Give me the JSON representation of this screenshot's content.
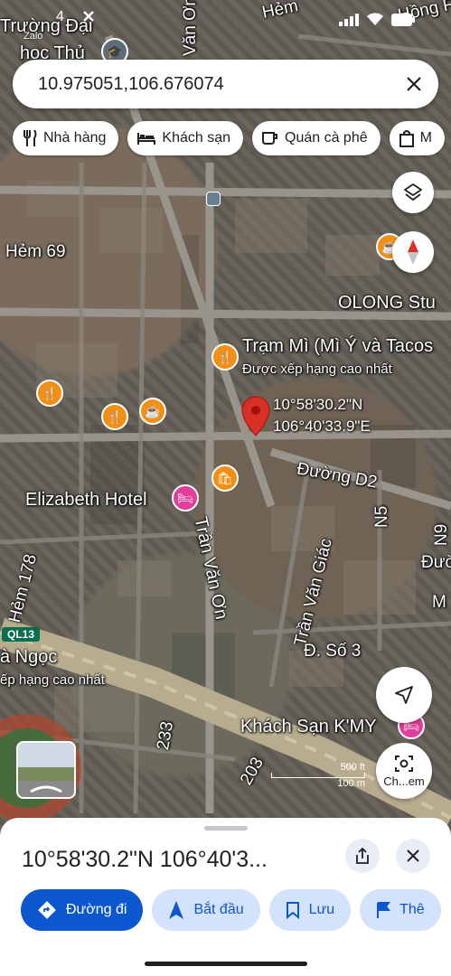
{
  "status_bar": {
    "time": "4",
    "zalo_label": "Zalo"
  },
  "search": {
    "query": "10.975051,106.676074"
  },
  "chips": [
    {
      "label": "Nhà hàng",
      "icon": "restaurant-icon"
    },
    {
      "label": "Khách sạn",
      "icon": "hotel-icon"
    },
    {
      "label": "Quán cà phê",
      "icon": "coffee-icon"
    },
    {
      "label": "M",
      "icon": "shopping-bag-icon"
    }
  ],
  "map": {
    "labels": {
      "truong_dai": "Trường Đại",
      "hoc_thu": "học Thủ",
      "hem_top": "Hẻm",
      "hong_fr": "Hồng Fr",
      "van_on_top": "Văn Ơn",
      "hem_69": "Hẻm 69",
      "olong": "OLONG Stu",
      "tram_mi": "Trạm Mì (Mì Ý và Tacos",
      "tram_mi_sub": "Được xếp hạng cao nhất",
      "elizabeth": "Elizabeth Hotel",
      "duong_d2": "Đường D2",
      "n5": "N5",
      "n9": "N9",
      "duong_right": "Đườ",
      "m_right": "M",
      "tran_van_on": "Trần Văn Ơn",
      "tran_van_giac": "Trần Văn Giác",
      "d_so_3": "Đ. Số 3",
      "hem_178": "Hẻm 178",
      "ql13": "QL13",
      "a_ngoc": "à Ngọc",
      "xep_hang": "ếp hạng cao nhất",
      "khach_san_kmy": "Khách Sạn K'MY",
      "road_233": "233",
      "road_203": "203"
    },
    "pin": {
      "lat": "10°58'30.2\"N",
      "lng": "106°40'33.9\"E"
    },
    "scale": {
      "ft": "500 ft",
      "m": "100 m"
    },
    "lens_label": "Ch...em"
  },
  "sheet": {
    "title": "10°58'30.2\"N 106°40'3...",
    "actions": [
      {
        "label": "Đường đi",
        "icon": "directions-icon",
        "primary": true
      },
      {
        "label": "Bắt đầu",
        "icon": "navigation-arrow-icon",
        "primary": false
      },
      {
        "label": "Lưu",
        "icon": "bookmark-icon",
        "primary": false
      },
      {
        "label": "Thê",
        "icon": "flag-icon",
        "primary": false
      }
    ]
  },
  "colors": {
    "accent": "#0b57d0",
    "chip_bg": "#d3e3fd",
    "pin": "#d93025",
    "poi_orange": "#f28f15",
    "poi_pink": "#e23e9b"
  }
}
